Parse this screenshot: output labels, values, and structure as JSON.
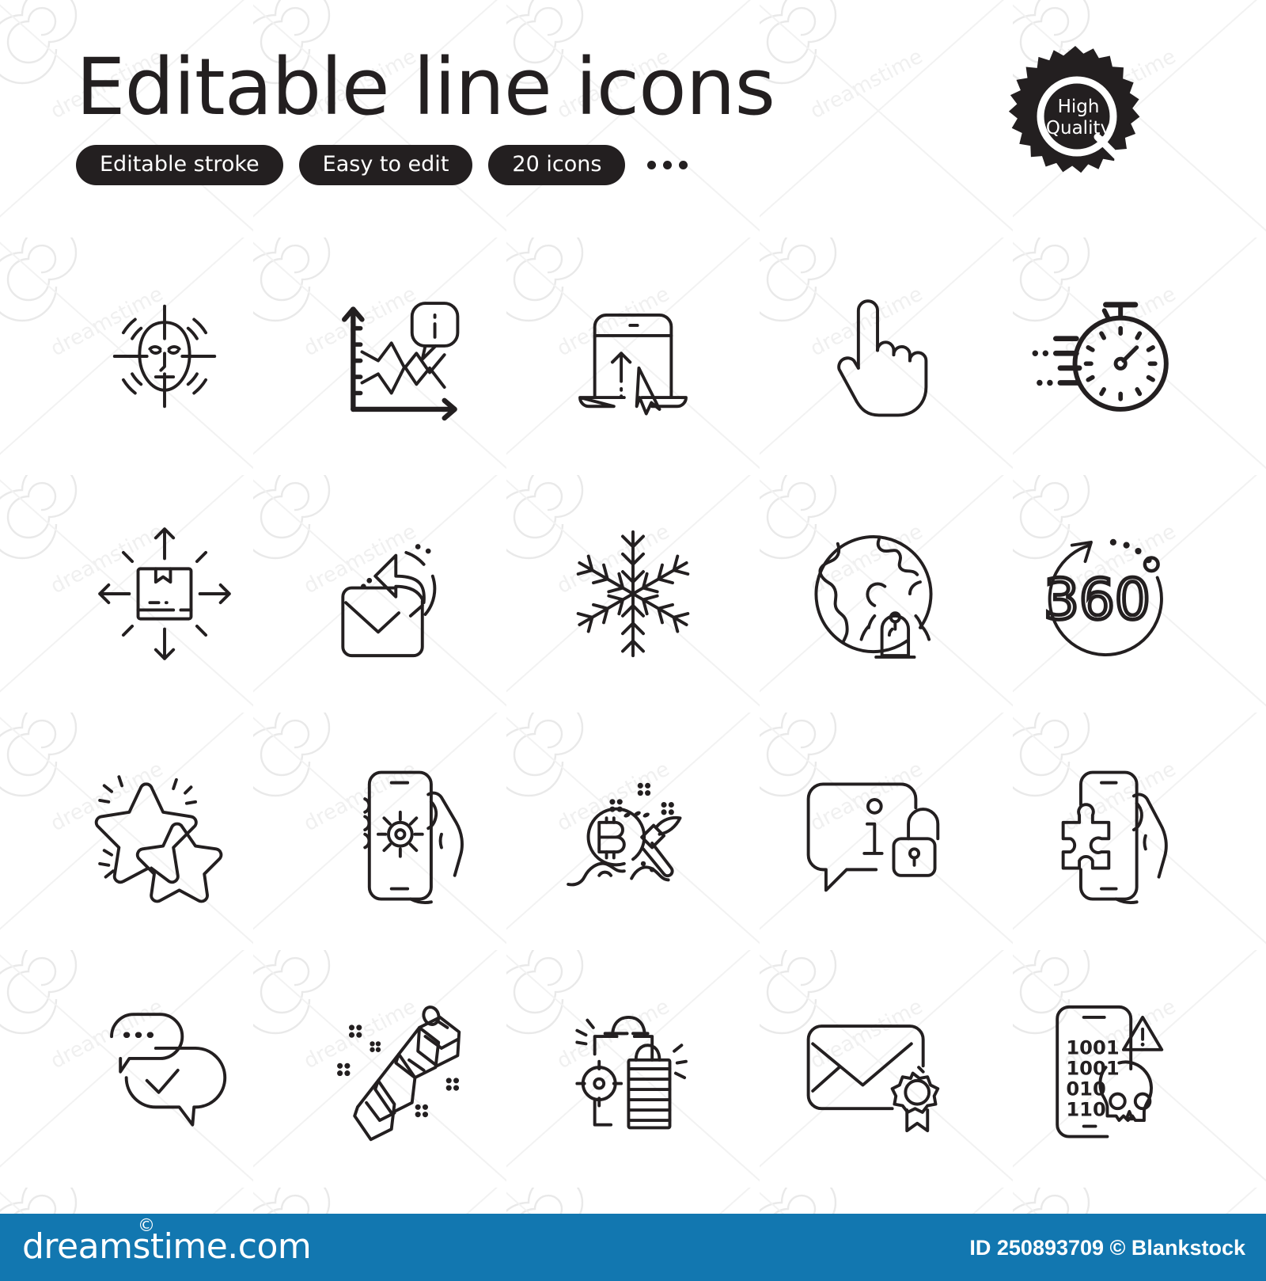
{
  "header": {
    "title": "Editable line icons",
    "pills": [
      {
        "label": "Editable stroke"
      },
      {
        "label": "Easy to edit"
      },
      {
        "label": "20 icons"
      }
    ],
    "ellipsis": "•••"
  },
  "badge": {
    "line1": "High",
    "line2": "Quality",
    "letter": "Q",
    "shape": "rosette-seal"
  },
  "grid": {
    "rows": 4,
    "columns": 5,
    "count": 20,
    "icons": [
      {
        "name": "face-detect-icon",
        "label": "Face detection"
      },
      {
        "name": "infochart-icon",
        "label": "Infochart"
      },
      {
        "name": "website-upload-icon",
        "label": "Website upload"
      },
      {
        "name": "hand-click-icon",
        "label": "Hand click"
      },
      {
        "name": "fast-timer-icon",
        "label": "Fast timer"
      },
      {
        "name": "parcel-delivery-icon",
        "label": "Parcel delivery"
      },
      {
        "name": "share-mail-icon",
        "label": "Share mail"
      },
      {
        "name": "snowflake-icon",
        "label": "Snowflake"
      },
      {
        "name": "world-alert-icon",
        "label": "World notification"
      },
      {
        "name": "360-degrees-icon",
        "label": "360 degrees"
      },
      {
        "name": "ranking-stars-icon",
        "label": "Ranking stars"
      },
      {
        "name": "phone-settings-icon",
        "label": "Phone settings"
      },
      {
        "name": "bitcoin-mining-icon",
        "label": "Bitcoin mining"
      },
      {
        "name": "private-info-icon",
        "label": "Private information"
      },
      {
        "name": "puzzle-phone-icon",
        "label": "Mobile puzzle"
      },
      {
        "name": "approved-message-icon",
        "label": "Approved message"
      },
      {
        "name": "chemistry-molecule-icon",
        "label": "Chemistry molecule"
      },
      {
        "name": "shopping-target-icon",
        "label": "Shopping target"
      },
      {
        "name": "verified-mail-icon",
        "label": "Verified mail"
      },
      {
        "name": "phone-virus-icon",
        "label": "Phone virus"
      }
    ],
    "phone_virus_binary": [
      "1001",
      "1001",
      "010",
      "110"
    ],
    "degrees_label": "360",
    "bitcoin_symbol": "B"
  },
  "footer": {
    "logo": "dreamstime.com",
    "logo_mark": "©",
    "credit": "ID 250893709 © Blankstock",
    "background": "#1277b0"
  },
  "colors": {
    "ink": "#231f20",
    "page": "#ffffff",
    "footer_blue": "#1277b0"
  }
}
